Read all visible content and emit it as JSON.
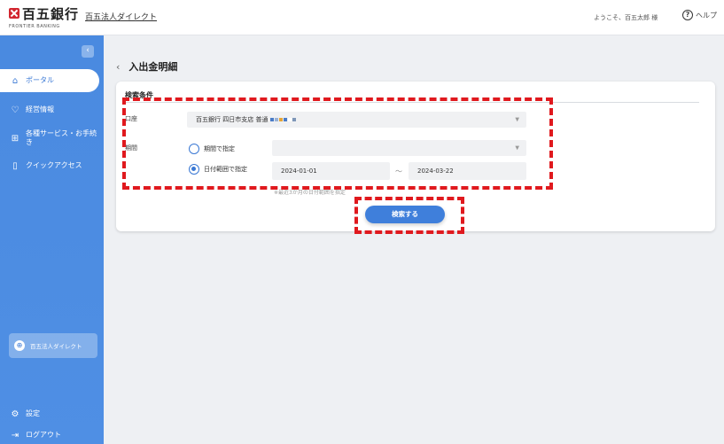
{
  "header": {
    "logo_title": "百五銀行",
    "logo_sub": "FRONTIER BANKING",
    "service_name": "百五法人ダイレクト",
    "welcome": "ようこそ、百五太郎 様",
    "help": "ヘルプ"
  },
  "sidebar": {
    "collapse": "‹",
    "items": [
      {
        "label": "ポータル",
        "icon": "home-icon",
        "active": true
      },
      {
        "label": "経営情報",
        "icon": "lightbulb-icon"
      },
      {
        "label": "各種サービス・お手続き",
        "icon": "grid-icon"
      },
      {
        "label": "クイックアクセス",
        "icon": "bookmark-icon"
      }
    ],
    "promo": "百五法人ダイレクト",
    "settings": "設定",
    "logout": "ログアウト"
  },
  "page": {
    "back": "‹",
    "title": "入出金明細"
  },
  "search": {
    "heading": "検索条件",
    "account_label": "口座",
    "account_value": "百五銀行 四日市支店 普通",
    "period_label": "期間",
    "option_period": "期間で指定",
    "option_range": "日付範囲で指定",
    "date_from": "2024-01-01",
    "date_to": "2024-03-22",
    "tilde": "〜",
    "note": "※最近3か月の日付範囲を指定",
    "submit": "検索する"
  },
  "colors": {
    "accent": "#3f7fdb",
    "sidebar": "#4a8ae0",
    "highlight": "#e0191e"
  }
}
